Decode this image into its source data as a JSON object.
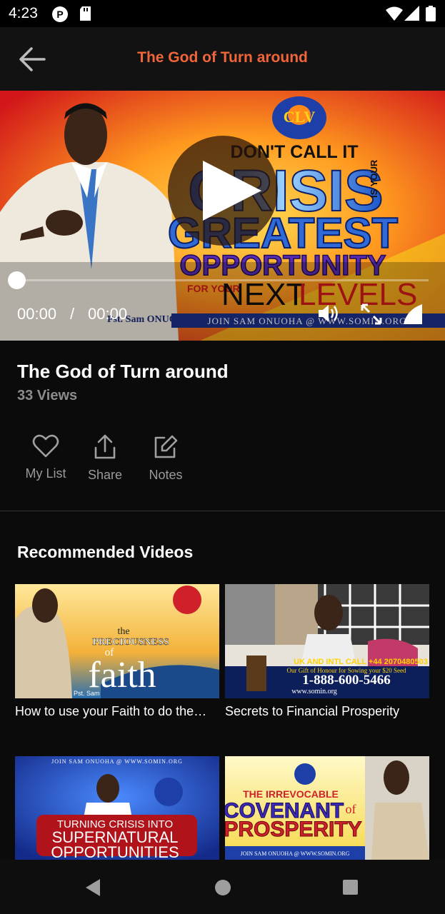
{
  "status_bar": {
    "time": "4:23"
  },
  "app_bar": {
    "title": "The God of Turn around"
  },
  "player": {
    "current_time": "00:00",
    "separator": "/",
    "duration": "00:00",
    "progress": 0,
    "thumbnail": {
      "top_text": "DON'T CALL IT",
      "big_word": "CRISIS",
      "side_text": "IS YOUR",
      "line3": "GREATEST",
      "line4": "OPPORTUNITY",
      "for_your": "FOR YOUR",
      "next": "NEXT",
      "levels": "LEVELS",
      "speaker": "Pst. Sam ONUOHA",
      "footer": "JOIN SAM ONUOHA @ WWW.SOMIN.ORG",
      "logo": "CLV"
    }
  },
  "video": {
    "title": "The God of Turn around",
    "views": "33 Views"
  },
  "actions": [
    {
      "label": "My List",
      "icon": "heart-icon"
    },
    {
      "label": "Share",
      "icon": "share-icon"
    },
    {
      "label": "Notes",
      "icon": "edit-icon"
    }
  ],
  "recommended": {
    "heading": "Recommended Videos",
    "items": [
      {
        "caption": "How to use your Faith to do the…",
        "t1": "the",
        "t2": "PRECIOUSNESS",
        "t3": "of",
        "t4": "faith",
        "t5": "Pst. Sam"
      },
      {
        "caption": "Secrets to Financial Prosperity",
        "t1": "UK AND INTL CALL +44 2070480503",
        "t2": "Our Gift of Honour for Sowing your $20 Seed",
        "t3": "1-888-600-5466",
        "t4": "www.somin.org"
      },
      {
        "caption": "",
        "t1": "JOIN SAM ONUOHA @ WWW.SOMIN.ORG",
        "t2": "TURNING CRISIS INTO",
        "t3": "SUPERNATURAL",
        "t4": "OPPORTUNITIES"
      },
      {
        "caption": "",
        "t1": "THE IRREVOCABLE",
        "t2": "COVENANT",
        "t3": "of",
        "t4": "PROSPERITY",
        "t5": "JOIN SAM ONUOHA @ WWW.SOMIN.ORG"
      }
    ]
  },
  "colors": {
    "accent": "#f0653a",
    "background": "#0b0b0b",
    "appbar": "#121212"
  }
}
